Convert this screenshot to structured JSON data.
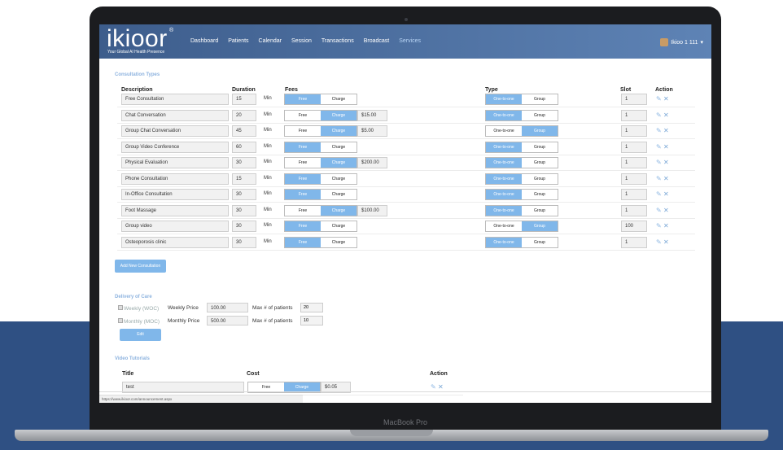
{
  "colors": {
    "nav_bg": "#3d5d8c",
    "accent_blue": "#80b7ea",
    "page_band": "#2f5083"
  },
  "device": {
    "label": "MacBook Pro"
  },
  "brand": {
    "logo_text": "ikioor",
    "logo_mark": "®",
    "tagline": "Your Global AI Health Presence"
  },
  "nav": {
    "items": [
      "Dashboard",
      "Patients",
      "Calendar",
      "Session",
      "Transactions",
      "Broadcast",
      "Services"
    ],
    "active": "Services",
    "user_name": "Ikioo 1 111",
    "dropdown_caret": "▾"
  },
  "consultation": {
    "section_title": "Consultation Types",
    "headers": {
      "description": "Description",
      "duration": "Duration",
      "fees": "Fees",
      "type": "Type",
      "slot": "Slot",
      "action": "Action"
    },
    "toggle_labels": {
      "free": "Free",
      "charge": "Charge",
      "one_to_one": "One-to-one",
      "group": "Group"
    },
    "unit_label": "Min",
    "rows": [
      {
        "description": "Free Consultation",
        "duration": "15",
        "fee_mode": "free",
        "fee": "",
        "type": "one-to-one",
        "slot": "1"
      },
      {
        "description": "Chat Conversation",
        "duration": "20",
        "fee_mode": "charge",
        "fee": "$15.00",
        "type": "one-to-one",
        "slot": "1"
      },
      {
        "description": "Group Chat Conversation",
        "duration": "45",
        "fee_mode": "charge",
        "fee": "$5.00",
        "type": "group",
        "slot": "1"
      },
      {
        "description": "Group Video Conference",
        "duration": "60",
        "fee_mode": "free",
        "fee": "",
        "type": "one-to-one",
        "slot": "1"
      },
      {
        "description": "Physical Evaluation",
        "duration": "30",
        "fee_mode": "charge",
        "fee": "$200.00",
        "type": "one-to-one",
        "slot": "1"
      },
      {
        "description": "Phone Consultation",
        "duration": "15",
        "fee_mode": "free",
        "fee": "",
        "type": "one-to-one",
        "slot": "1"
      },
      {
        "description": "In-Office Consultation",
        "duration": "30",
        "fee_mode": "free",
        "fee": "",
        "type": "one-to-one",
        "slot": "1"
      },
      {
        "description": "Foot Massage",
        "duration": "30",
        "fee_mode": "charge",
        "fee": "$100.00",
        "type": "one-to-one",
        "slot": "1"
      },
      {
        "description": "Group video",
        "duration": "30",
        "fee_mode": "free",
        "fee": "",
        "type": "group",
        "slot": "100"
      },
      {
        "description": "Osteoporosis clinic",
        "duration": "30",
        "fee_mode": "free",
        "fee": "",
        "type": "one-to-one",
        "slot": "1"
      }
    ],
    "add_button": "Add New Consultation"
  },
  "delivery": {
    "section_title": "Delivery of Care",
    "weekly": {
      "checkbox_label": "Weekly (WOC)",
      "price_label": "Weekly Price",
      "price": "100.00",
      "max_label": "Max # of patients",
      "max_value": "20"
    },
    "monthly": {
      "checkbox_label": "Monthly (MOC)",
      "price_label": "Monthly Price",
      "price": "500.00",
      "max_label": "Max # of patients",
      "max_value": "10"
    },
    "edit_button": "Edit"
  },
  "tutorials": {
    "section_title": "Video Tutorials",
    "headers": {
      "title": "Title",
      "cost": "Cost",
      "action": "Action"
    },
    "rows": [
      {
        "title": "test",
        "fee_mode": "charge",
        "fee": "$0.05"
      }
    ]
  },
  "statusbar": {
    "url": "https://www.ikioor.com/announcement.aspx"
  }
}
